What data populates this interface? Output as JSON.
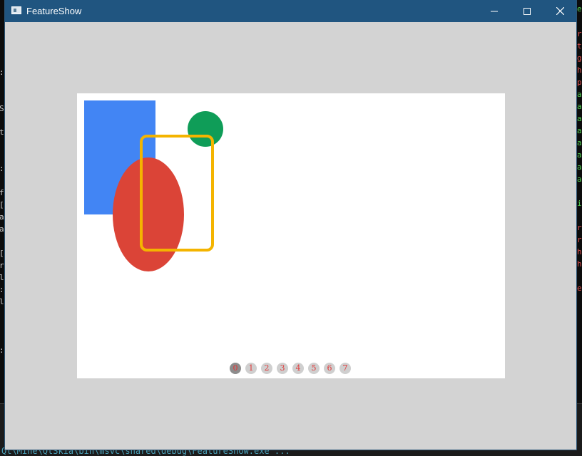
{
  "window": {
    "title": "FeatureShow",
    "controls": {
      "minimize": "—",
      "maximize": "☐",
      "close": "✕"
    }
  },
  "canvas": {
    "shapes": [
      {
        "kind": "rectangle",
        "color": "#4285F4"
      },
      {
        "kind": "circle",
        "color": "#0F9D58"
      },
      {
        "kind": "ellipse",
        "color": "#DB4437"
      },
      {
        "kind": "rounded-rect-outline",
        "color": "#F4B400"
      }
    ],
    "pager": {
      "pages": [
        "0",
        "1",
        "2",
        "3",
        "4",
        "5",
        "6",
        "7"
      ],
      "active_index": 0
    }
  },
  "console": {
    "left_chars": [
      ":",
      "S",
      "t",
      ":",
      "f",
      "[",
      "a",
      "a",
      "[",
      "r",
      "l",
      ":",
      "l",
      ":"
    ],
    "right_chars": [
      {
        "t": "e",
        "c": "green"
      },
      {
        "t": "r",
        "c": "red"
      },
      {
        "t": "t",
        "c": "red"
      },
      {
        "t": "g",
        "c": "red"
      },
      {
        "t": "h",
        "c": "red"
      },
      {
        "t": "p",
        "c": "red"
      },
      {
        "t": "a",
        "c": "green"
      },
      {
        "t": "a",
        "c": "green"
      },
      {
        "t": "a",
        "c": "green"
      },
      {
        "t": "a",
        "c": "green"
      },
      {
        "t": "a",
        "c": "green"
      },
      {
        "t": "a",
        "c": "green"
      },
      {
        "t": "a",
        "c": "green"
      },
      {
        "t": "a",
        "c": "green"
      },
      {
        "t": "i",
        "c": "green"
      },
      {
        "t": "r",
        "c": "red"
      },
      {
        "t": "r",
        "c": "red"
      },
      {
        "t": "h",
        "c": "red"
      },
      {
        "t": "h",
        "c": "red"
      },
      {
        "t": "e",
        "c": "red"
      }
    ],
    "bottom_command": "Qt\\Mine\\QtSkia\\bin\\msvc\\shared\\debug\\FeatureShow.exe ..."
  }
}
